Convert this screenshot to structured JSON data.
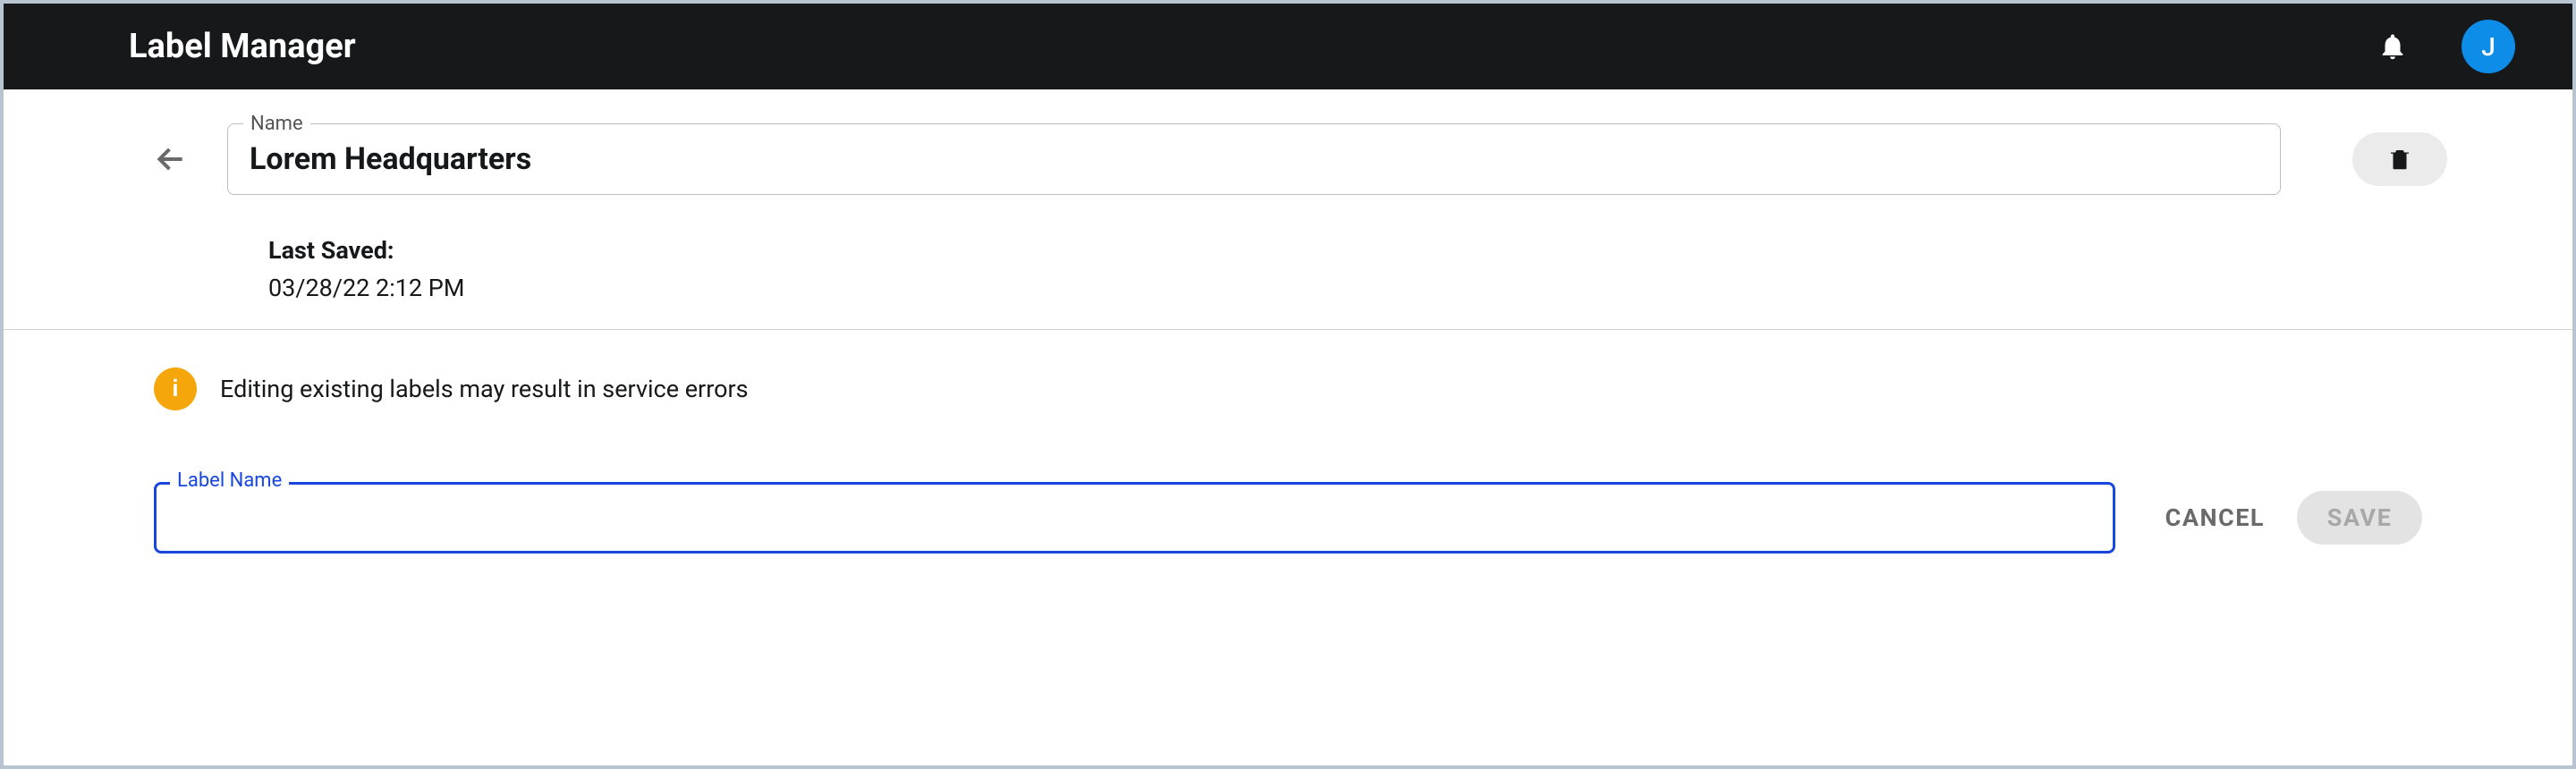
{
  "header": {
    "title": "Label Manager",
    "avatar_initial": "J"
  },
  "name_field": {
    "label": "Name",
    "value": "Lorem Headquarters"
  },
  "last_saved": {
    "label": "Last Saved:",
    "value": "03/28/22 2:12 PM"
  },
  "warning": {
    "text": "Editing existing labels may result in service errors"
  },
  "label_name_field": {
    "label": "Label Name",
    "value": ""
  },
  "buttons": {
    "cancel": "CANCEL",
    "save": "SAVE"
  }
}
